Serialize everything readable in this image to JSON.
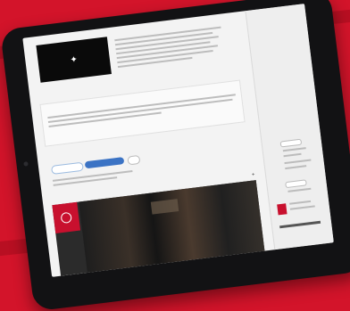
{
  "tablet": {
    "screen": {
      "video": {
        "icon": "star-icon"
      },
      "tabs": [],
      "pills": [],
      "sidebar": {}
    }
  },
  "colors": {
    "background": "#d3142a",
    "brand_red": "#c8102e",
    "pill_blue": "#3b73c4"
  }
}
